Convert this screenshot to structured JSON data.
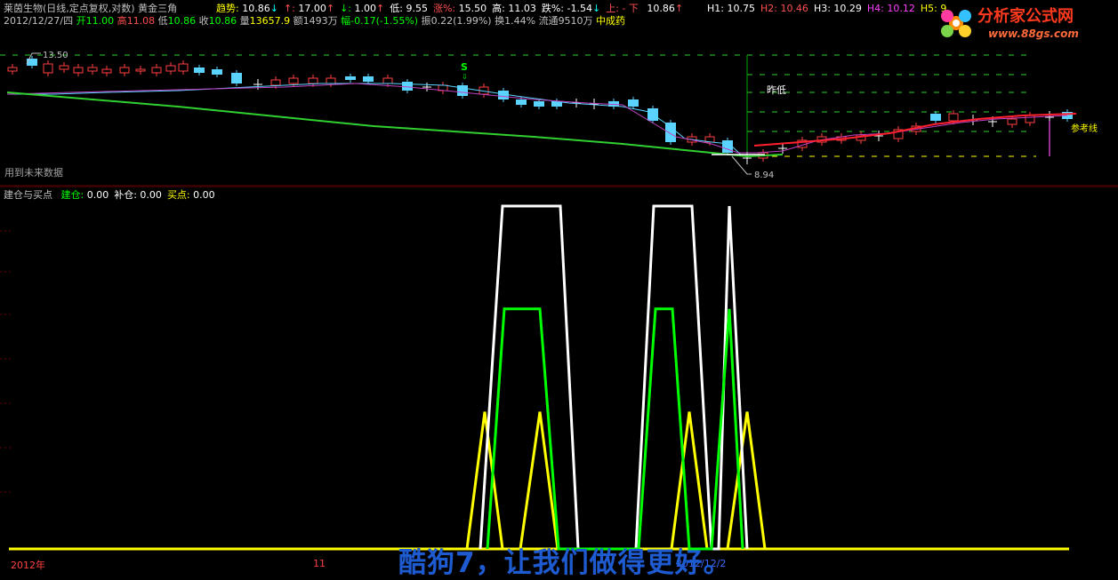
{
  "header": {
    "stock_title": "莱茵生物(日线,定点复权,对数)",
    "indicator_name": "黄金三角",
    "stats": [
      {
        "label": "趋势",
        "value": "10.86",
        "arrow": "↓",
        "color": "#ffff00",
        "valcolor": "#ffffff",
        "arrowcolor": "#00ffff"
      },
      {
        "label": "↑",
        "value": "17.00",
        "arrow": "↑",
        "color": "#ff5050",
        "valcolor": "#ffffff",
        "arrowcolor": "#ff5050"
      },
      {
        "label": "↓",
        "value": "1.00",
        "arrow": "↑",
        "color": "#00ff00",
        "valcolor": "#ffffff",
        "arrowcolor": "#ff5050"
      },
      {
        "label": "低",
        "value": "9.55",
        "arrow": "",
        "color": "#ffffff",
        "valcolor": "#ffffff",
        "arrowcolor": "#ffffff"
      },
      {
        "label": "涨%",
        "value": "15.50",
        "arrow": "",
        "color": "#ff5050",
        "valcolor": "#ffffff",
        "arrowcolor": "#ffffff"
      },
      {
        "label": "高",
        "value": "11.03",
        "arrow": "",
        "color": "#ffffff",
        "valcolor": "#ffffff",
        "arrowcolor": "#ffffff"
      },
      {
        "label": "跌%",
        "value": "-1.54",
        "arrow": "↓",
        "color": "#ffffff",
        "valcolor": "#ffffff",
        "arrowcolor": "#00ffff"
      },
      {
        "label": "上",
        "value": "- 下",
        "arrow": "",
        "color": "#ff5050",
        "valcolor": "#ff5050",
        "arrowcolor": "#ffffff"
      },
      {
        "label": "",
        "value": "10.86",
        "arrow": "↑",
        "color": "#ffffff",
        "valcolor": "#ffffff",
        "arrowcolor": "#ff5050"
      }
    ],
    "h_levels": [
      {
        "label": "H1",
        "value": "10.75",
        "color": "#ffffff"
      },
      {
        "label": "H2",
        "value": "10.46",
        "color": "#ff5050"
      },
      {
        "label": "H3",
        "value": "10.29",
        "color": "#ffffff"
      },
      {
        "label": "H4",
        "value": "10.12",
        "color": "#ff40ff"
      },
      {
        "label": "H5",
        "value": "9",
        "color": "#ffff00"
      }
    ],
    "quote": {
      "date": "2012/12/27/四",
      "open_label": "开",
      "open": "11.00",
      "high_label": "高",
      "high": "11.08",
      "low_label": "低",
      "low": "10.86",
      "close_label": "收",
      "close": "10.86",
      "vol_label": "量",
      "vol": "13657.9",
      "amount_label": "额",
      "amount": "1493万",
      "change_label": "幅",
      "change": "-0.17(-1.55%)",
      "swing_label": "振",
      "swing": "0.22(1.99%)",
      "turnover_label": "换",
      "turnover": "1.44%",
      "float_label": "流通",
      "float": "9510万",
      "sector": "中成药"
    }
  },
  "logo": {
    "text": "分析家公式网",
    "url": "www.88gs.com"
  },
  "main_panel": {
    "high_marker": "13.50",
    "low_marker": "8.94",
    "s_marker": "S",
    "label_zuodi": "昨低",
    "label_cankao": "参考线",
    "note": "用到未来数据"
  },
  "indicator_panel": {
    "name": "建仓与买点",
    "items": [
      {
        "label": "建仓",
        "value": "0.00",
        "color": "#00ff00"
      },
      {
        "label": "补仓",
        "value": "0.00",
        "color": "#ffffff"
      },
      {
        "label": "买点",
        "value": "0.00",
        "color": "#ffff00"
      }
    ]
  },
  "x_axis": {
    "labels": [
      "2012年",
      "11",
      "2012/12/2"
    ]
  },
  "watermark": "酷狗7，让我们做得更好。",
  "chart_data": [
    {
      "type": "line",
      "title": "黄金三角",
      "series": [],
      "annotations": [
        "13.50",
        "8.94",
        "S",
        "昨低",
        "参考线"
      ]
    },
    {
      "type": "line",
      "title": "建仓与买点",
      "series": [
        {
          "name": "补仓",
          "color": "#ffffff",
          "points": [
            [
              540,
              0
            ],
            [
              565,
              100
            ],
            [
              630,
              100
            ],
            [
              650,
              0
            ],
            [
              715,
              0
            ],
            [
              735,
              100
            ],
            [
              778,
              100
            ],
            [
              800,
              0
            ],
            [
              808,
              0
            ],
            [
              820,
              100
            ],
            [
              840,
              0
            ]
          ]
        },
        {
          "name": "建仓",
          "color": "#00ff00",
          "points": [
            [
              548,
              0
            ],
            [
              567,
              70
            ],
            [
              607,
              70
            ],
            [
              628,
              0
            ],
            [
              718,
              0
            ],
            [
              737,
              70
            ],
            [
              756,
              70
            ],
            [
              775,
              0
            ],
            [
              800,
              0
            ],
            [
              820,
              70
            ],
            [
              835,
              0
            ]
          ]
        },
        {
          "name": "买点",
          "color": "#ffff00",
          "points": [
            [
              525,
              0
            ],
            [
              545,
              40
            ],
            [
              565,
              0
            ],
            [
              585,
              0
            ],
            [
              607,
              40
            ],
            [
              627,
              0
            ],
            [
              755,
              0
            ],
            [
              775,
              40
            ],
            [
              795,
              0
            ],
            [
              818,
              0
            ],
            [
              840,
              40
            ],
            [
              860,
              0
            ]
          ]
        }
      ],
      "ylim": [
        0,
        100
      ]
    }
  ]
}
